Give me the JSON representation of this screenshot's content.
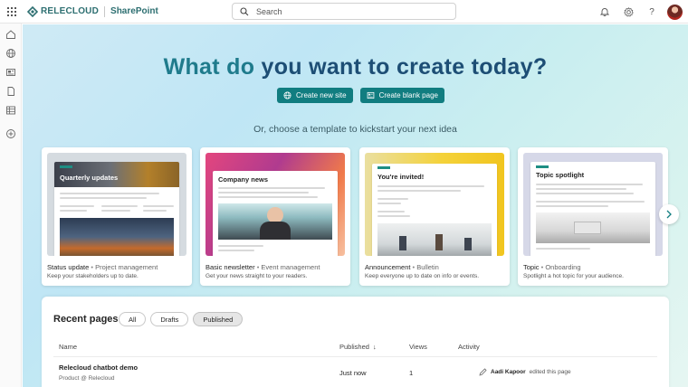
{
  "topbar": {
    "brand_name": "RELECLOUD",
    "app_name": "SharePoint",
    "search_placeholder": "Search",
    "icons": [
      "bell-icon",
      "gear-icon",
      "help-icon"
    ],
    "help_glyph": "?"
  },
  "rail": {
    "icons": [
      "home-icon",
      "globe-icon",
      "news-icon",
      "document-icon",
      "list-icon",
      "add-circle-icon"
    ]
  },
  "hero": {
    "title_part1": "What do ",
    "title_part2": "you want to create today?",
    "create_site_label": "Create new site",
    "create_page_label": "Create blank page",
    "subtitle": "Or, choose a template to kickstart your next idea"
  },
  "templates": [
    {
      "thumb_title": "Quarterly updates",
      "name": "Status update",
      "category": "Project management",
      "description": "Keep your stakeholders up to date."
    },
    {
      "thumb_title": "Company news",
      "name": "Basic newsletter",
      "category": "Event management",
      "description": "Get your news straight to your readers."
    },
    {
      "thumb_title": "You're invited!",
      "name": "Announcement",
      "category": "Bulletin",
      "description": "Keep everyone up to date on info or events."
    },
    {
      "thumb_title": "Topic spotlight",
      "name": "Topic",
      "category": "Onboarding",
      "description": "Spotlight a hot topic for your audience."
    }
  ],
  "template_separator": " • ",
  "recent": {
    "title": "Recent pages",
    "filters": [
      {
        "label": "All",
        "active": false
      },
      {
        "label": "Drafts",
        "active": false
      },
      {
        "label": "Published",
        "active": true
      }
    ],
    "columns": {
      "name": "Name",
      "published": "Published",
      "views": "Views",
      "activity": "Activity"
    },
    "sort_glyph": "↓",
    "rows": [
      {
        "name": "Relecloud chatbot demo",
        "site": "Product @ Relecloud",
        "published": "Just now",
        "views": "1",
        "activity_user": "Aadi Kapoor",
        "activity_text": "edited this page"
      }
    ]
  },
  "colors": {
    "brand": "#2d6f71",
    "primary_button": "#117d80",
    "title_teal": "#1f7b8c",
    "title_navy": "#1d4e75"
  }
}
